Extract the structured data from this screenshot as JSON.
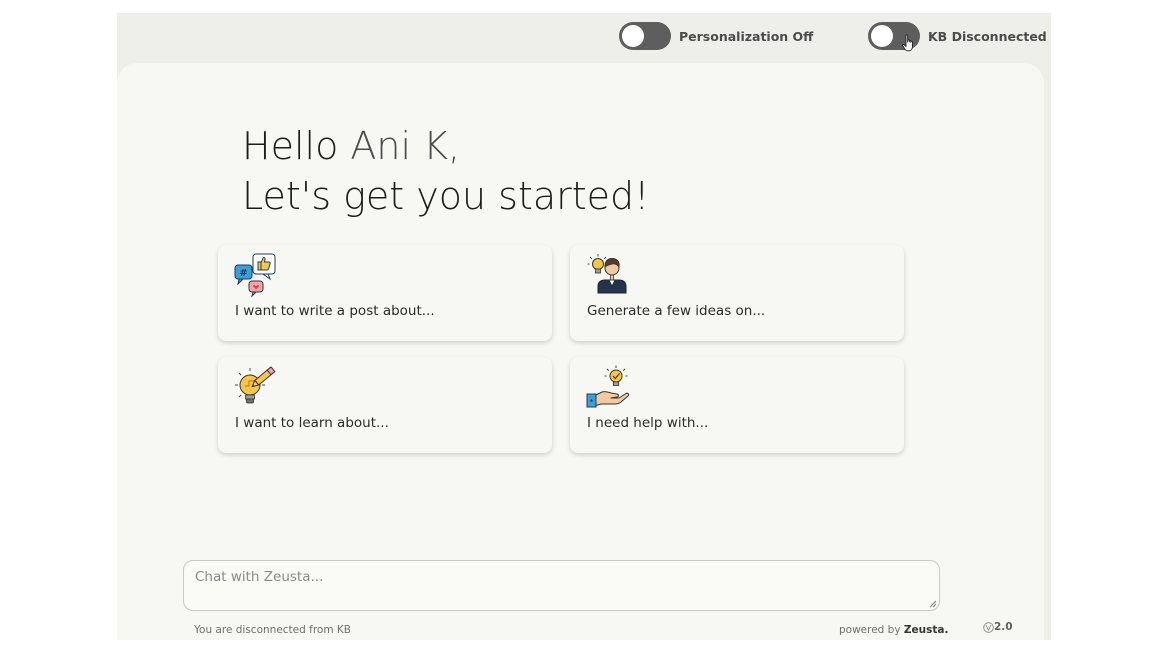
{
  "topbar": {
    "personalization": {
      "label": "Personalization Off",
      "enabled": false
    },
    "kb": {
      "label": "KB Disconnected",
      "enabled": false
    }
  },
  "greeting": {
    "hello": "Hello",
    "name": "Ani K,",
    "subtitle": "Let's get you started!"
  },
  "cards": [
    {
      "label": "I want to write a post about...",
      "icon": "social-post-icon"
    },
    {
      "label": "Generate a few ideas on...",
      "icon": "idea-person-icon"
    },
    {
      "label": "I want to learn about...",
      "icon": "learn-bulb-icon"
    },
    {
      "label": "I need help with...",
      "icon": "help-hand-icon"
    }
  ],
  "chat": {
    "placeholder": "Chat with Zeusta..."
  },
  "footer": {
    "status": "You are disconnected from KB",
    "powered_prefix": "powered by",
    "brand": "Zeusta.",
    "version": "2.0"
  },
  "colors": {
    "toggle_off": "#5e5e5e",
    "panel_bg": "#f7f7f3",
    "app_bg": "#eeeeea",
    "bulb": "#f6c744",
    "accent_blue": "#3aa0d8"
  }
}
